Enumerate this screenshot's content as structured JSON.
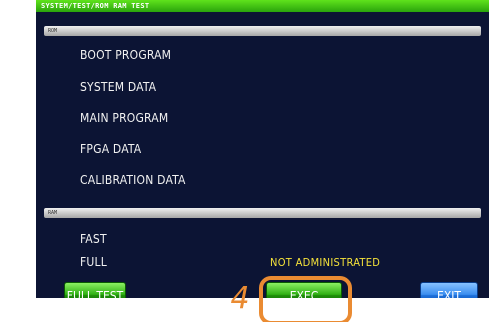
{
  "window": {
    "title": "SYSTEM/TEST/ROM RAM TEST"
  },
  "rom_section": {
    "header": "ROM",
    "items": [
      {
        "label": "BOOT PROGRAM"
      },
      {
        "label": "SYSTEM DATA"
      },
      {
        "label": "MAIN PROGRAM"
      },
      {
        "label": "FPGA DATA"
      },
      {
        "label": "CALIBRATION DATA"
      }
    ]
  },
  "ram_section": {
    "header": "RAM",
    "items": [
      {
        "label": "FAST"
      },
      {
        "label": "FULL"
      }
    ],
    "status": "NOT ADMINISTRATED"
  },
  "buttons": {
    "full_test": "FULL TEST",
    "exec": "EXEC",
    "exit": "EXIT"
  },
  "callout": {
    "step": "4"
  },
  "colors": {
    "background": "#0c1434",
    "title_bar": "#3cc214",
    "status_text": "#f5e23a",
    "green_button": "#2fb013",
    "blue_button": "#1d6fd9",
    "callout": "#ea8b32"
  }
}
